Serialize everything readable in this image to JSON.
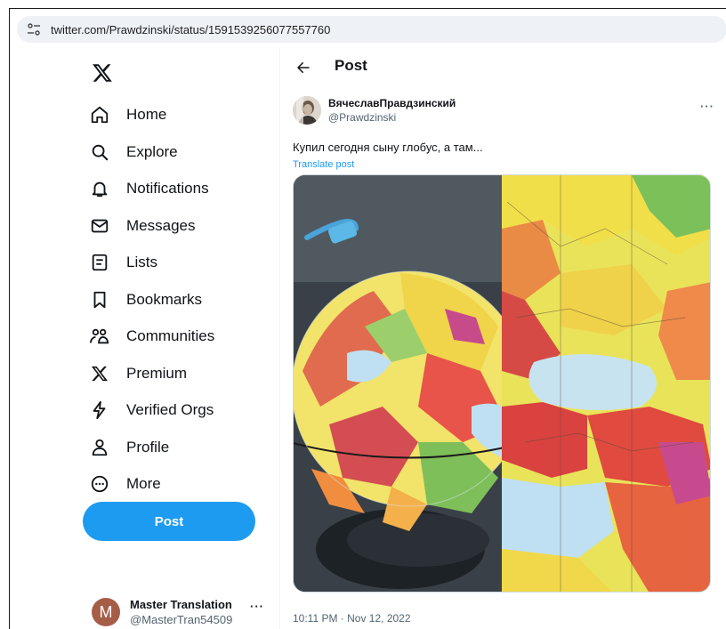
{
  "browser": {
    "url": "twitter.com/Prawdzinski/status/1591539256077557760"
  },
  "nav": {
    "logo": "x-logo",
    "items": [
      {
        "label": "Home",
        "icon": "home-icon"
      },
      {
        "label": "Explore",
        "icon": "search-icon"
      },
      {
        "label": "Notifications",
        "icon": "bell-icon"
      },
      {
        "label": "Messages",
        "icon": "envelope-icon"
      },
      {
        "label": "Lists",
        "icon": "list-icon"
      },
      {
        "label": "Bookmarks",
        "icon": "bookmark-icon"
      },
      {
        "label": "Communities",
        "icon": "people-icon"
      },
      {
        "label": "Premium",
        "icon": "x-icon"
      },
      {
        "label": "Verified Orgs",
        "icon": "lightning-icon"
      },
      {
        "label": "Profile",
        "icon": "person-icon"
      },
      {
        "label": "More",
        "icon": "more-circle-icon"
      }
    ],
    "post_button": "Post"
  },
  "account": {
    "avatar_letter": "M",
    "display_name": "Master Translation",
    "handle": "@MasterTran54509",
    "menu": "···"
  },
  "post": {
    "header_title": "Post",
    "author_name": "ВячеславПравдзинский",
    "author_handle": "@Prawdzinski",
    "more": "···",
    "text": "Купил сегодня сыну глобус, а там...",
    "translate": "Translate post",
    "timestamp": "10:11 PM · Nov 12, 2022"
  },
  "colors": {
    "accent": "#1d9bf0",
    "avatar_bg": "#a55d48",
    "secondary_text": "#536471"
  }
}
